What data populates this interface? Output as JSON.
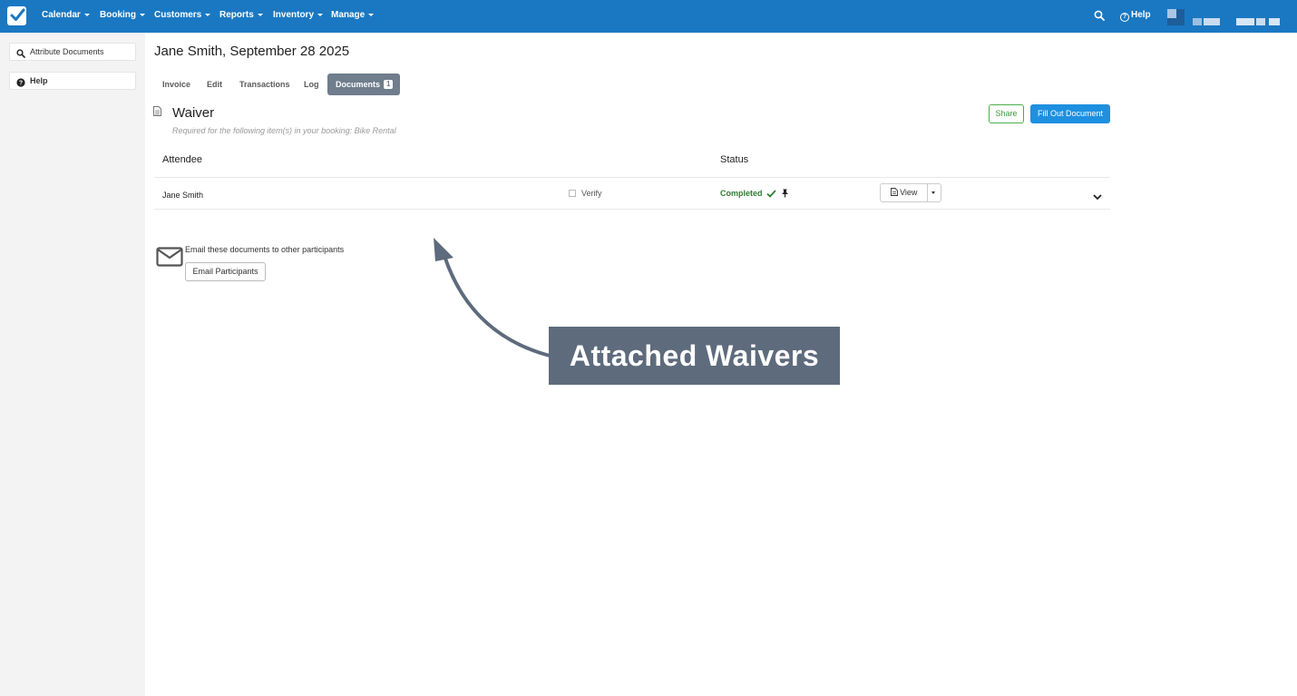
{
  "nav": {
    "items": [
      {
        "label": "Calendar"
      },
      {
        "label": "Booking"
      },
      {
        "label": "Customers"
      },
      {
        "label": "Reports"
      },
      {
        "label": "Inventory"
      },
      {
        "label": "Manage"
      }
    ],
    "help_label": "Help",
    "icons": [
      "checkbox-logo-icon",
      "search-icon",
      "help-circle-icon"
    ],
    "accent_color": "#1a78c2"
  },
  "sidebar": {
    "items": [
      {
        "label": "Attribute Documents",
        "icon": "search-icon"
      },
      {
        "label": "Help",
        "icon": "question-circle-icon"
      }
    ]
  },
  "page": {
    "title": "Jane Smith, September 28 2025"
  },
  "tabs": [
    {
      "label": "Invoice"
    },
    {
      "label": "Edit"
    },
    {
      "label": "Transactions"
    },
    {
      "label": "Log"
    },
    {
      "label": "Documents",
      "badge": "1",
      "active": true
    }
  ],
  "document": {
    "title": "Waiver",
    "subtitle": "Required for the following item(s) in your booking: Bike Rental",
    "share_label": "Share",
    "fill_label": "Fill Out Document"
  },
  "table": {
    "headers": [
      "Attendee",
      "Status"
    ],
    "rows": [
      {
        "attendee": "Jane Smith",
        "verify_label": "Verify",
        "status": "Completed",
        "view_label": "View"
      }
    ]
  },
  "email": {
    "text": "Email these documents to other participants",
    "button_label": "Email Participants"
  },
  "annotation": {
    "callout": "Attached Waivers",
    "color": "#5d6b7c"
  }
}
